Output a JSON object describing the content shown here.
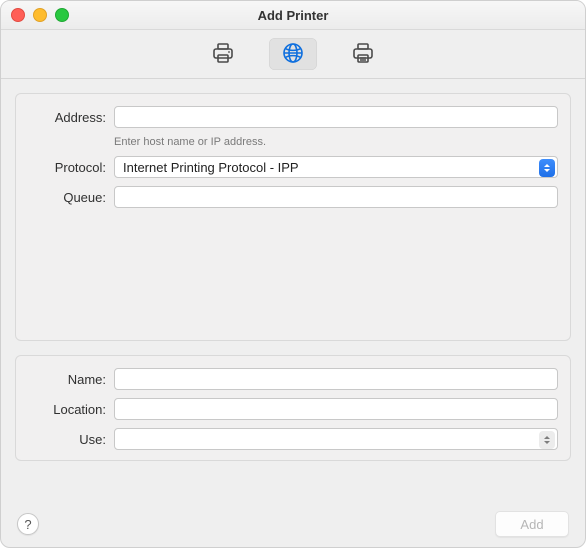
{
  "window": {
    "title": "Add Printer"
  },
  "tabs": {
    "default_label": "Default",
    "ip_label": "IP",
    "windows_label": "Windows",
    "selected": "ip"
  },
  "form": {
    "address": {
      "label": "Address:",
      "value": "",
      "hint": "Enter host name or IP address."
    },
    "protocol": {
      "label": "Protocol:",
      "selected": "Internet Printing Protocol - IPP"
    },
    "queue": {
      "label": "Queue:",
      "value": ""
    },
    "name": {
      "label": "Name:",
      "value": ""
    },
    "location": {
      "label": "Location:",
      "value": ""
    },
    "use": {
      "label": "Use:",
      "selected": ""
    }
  },
  "footer": {
    "help_char": "?",
    "add_label": "Add"
  }
}
